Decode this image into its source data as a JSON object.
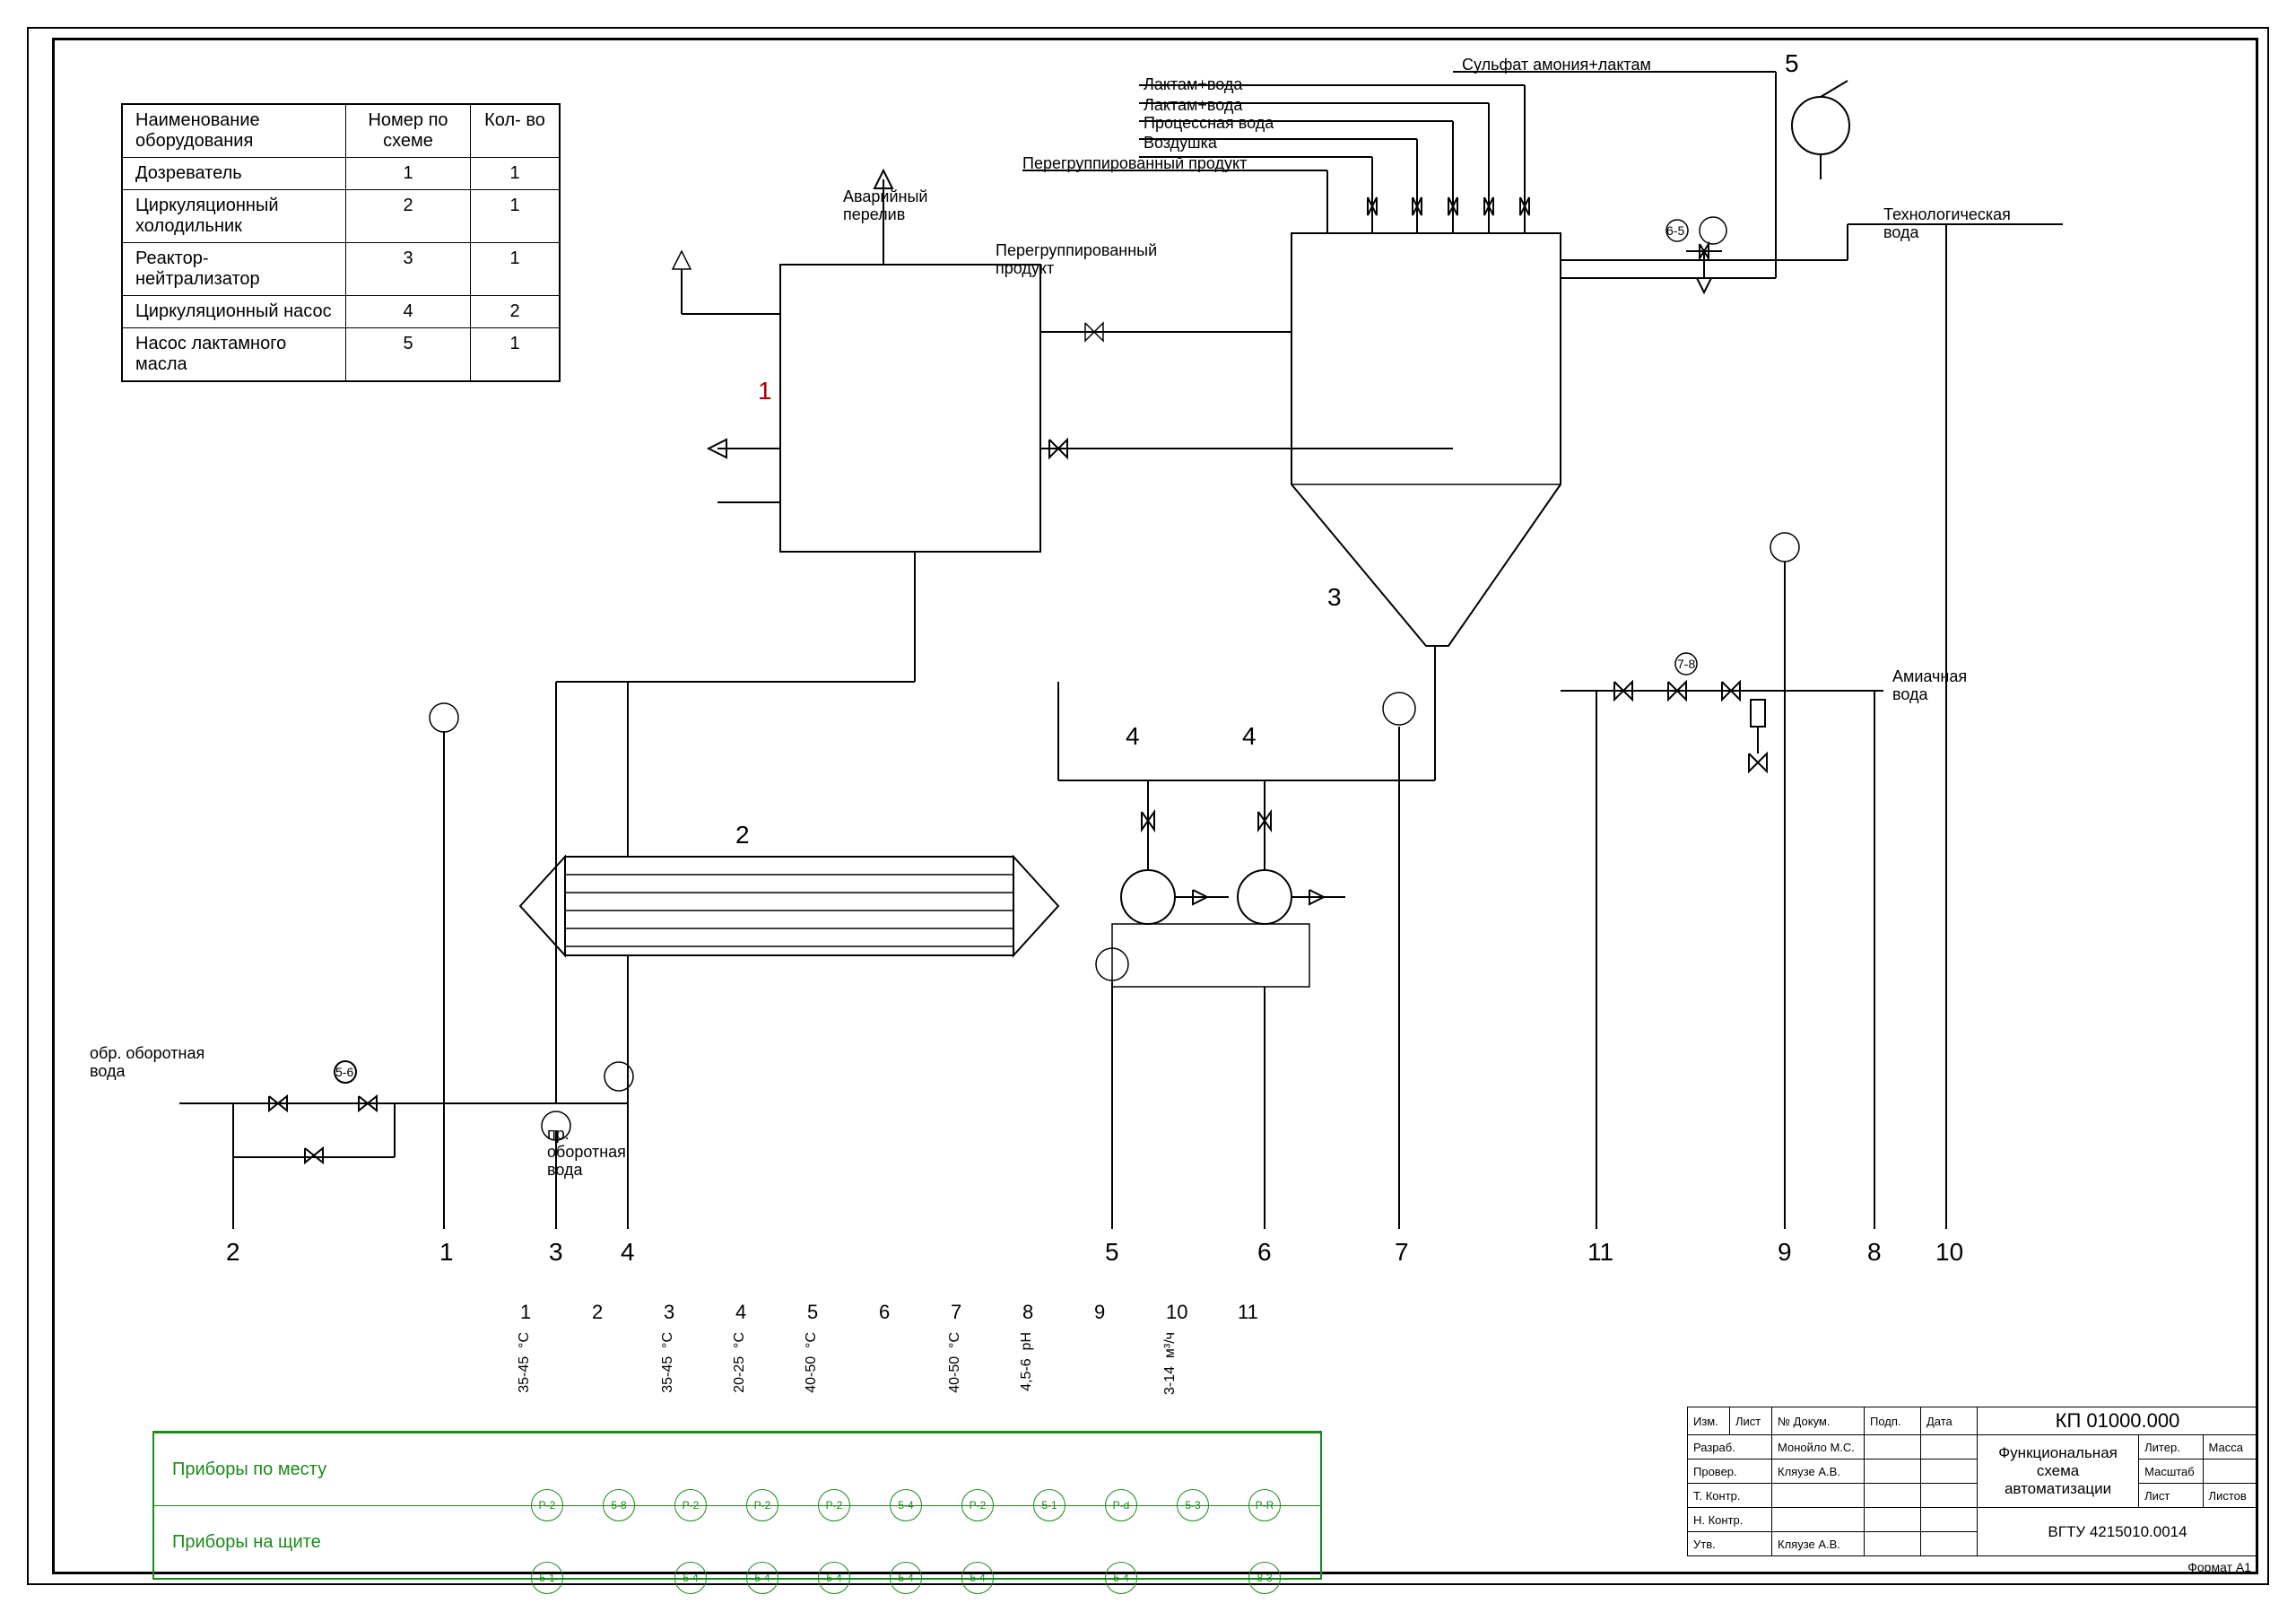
{
  "equipment_table": {
    "headers": [
      "Наименование\nоборудования",
      "Номер по\nсхеме",
      "Кол-\nво"
    ],
    "rows": [
      [
        "Дозреватель",
        "1",
        "1"
      ],
      [
        "Циркуляционный\nхолодильник",
        "2",
        "1"
      ],
      [
        "Реактор-\nнейтрализатор",
        "3",
        "1"
      ],
      [
        "Циркуляционный\nнасос",
        "4",
        "2"
      ],
      [
        "Насос лактамного\nмасла",
        "5",
        "1"
      ]
    ]
  },
  "stream_labels": {
    "avariyniy_pereliv": "Аварийный\nперелив",
    "peregr_product_top": "Перегруппированный\nпродукт",
    "peregr_product": "Перегруппированный продукт",
    "laktam_voda1": "Лактам+вода",
    "laktam_voda2": "Лактам+вода",
    "process_voda": "Процессная вода",
    "vozdushka": "Воздушка",
    "sulfat": "Сульфат амония+лактам",
    "tech_voda": "Технологическая\nвода",
    "amiach_voda": "Амиачная\nвода",
    "obr_oborot": "обр. оборотная\nвода",
    "pr_oborot": "пр.\nоборотная\nвода"
  },
  "equipment_numbers": {
    "n1": "1",
    "n2": "2",
    "n3": "3",
    "n4a": "4",
    "n4b": "4",
    "n5": "5"
  },
  "bottom_channel_numbers": [
    "2",
    "1",
    "3",
    "4",
    "5",
    "6",
    "7",
    "11",
    "9",
    "8",
    "10"
  ],
  "instrument_channels": {
    "cols": [
      "1",
      "2",
      "3",
      "4",
      "5",
      "6",
      "7",
      "8",
      "9",
      "10",
      "11"
    ],
    "ranges": [
      "35-45",
      "",
      "35-45",
      "20-25",
      "40-50",
      "",
      "40-50",
      "4,5-6",
      "",
      "3-14",
      ""
    ],
    "units": [
      "°C",
      "",
      "°C",
      "°C",
      "°C",
      "",
      "°C",
      "pH",
      "",
      "м³/ч",
      ""
    ],
    "row1_label": "Приборы по месту",
    "row2_label": "Приборы на щите",
    "row1_tags": [
      "P-2",
      "5-8",
      "P-2",
      "P-2",
      "P-2",
      "5-4",
      "P-2",
      "5-1",
      "P-d",
      "5-3",
      "P-R"
    ],
    "row2_tags": [
      "5-1",
      "",
      "5-4",
      "5-4",
      "5-4",
      "5-4",
      "5-4",
      "",
      "5-4",
      "",
      "8-3"
    ]
  },
  "title_block": {
    "doc_no": "КП 01000.000",
    "title1": "Функциональная",
    "title2": "схема автоматизации",
    "rows_left": [
      [
        "Изм.",
        "Лист",
        "№ Докум.",
        "Подп.",
        "Дата"
      ],
      [
        "Разраб.",
        "Монойло М.С.",
        "",
        ""
      ],
      [
        "Провер.",
        "Кляузе А.В.",
        "",
        ""
      ],
      [
        "Т. Контр.",
        "",
        "",
        ""
      ],
      [
        "",
        "",
        "",
        ""
      ],
      [
        "Н. Контр.",
        "",
        "",
        ""
      ],
      [
        "Утв.",
        "Кляузе А.В.",
        "",
        ""
      ]
    ],
    "cols_right_top": [
      "Литер.",
      "Масса",
      "Масштаб"
    ],
    "cols_right_bot": [
      "Лист",
      "Листов"
    ],
    "org": "ВГТУ 4215010.0014",
    "format": "Формат    А1"
  }
}
